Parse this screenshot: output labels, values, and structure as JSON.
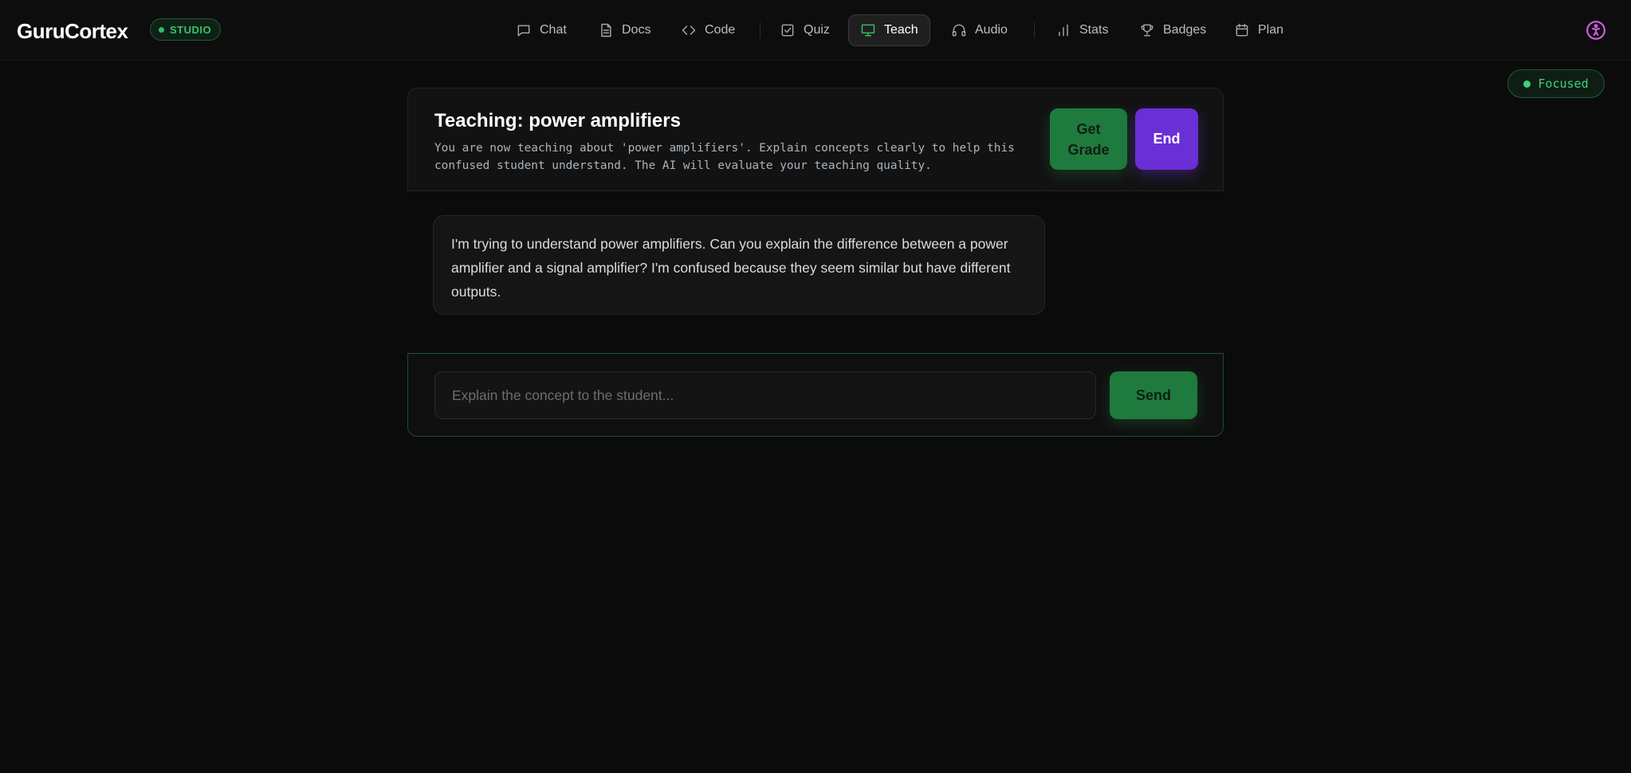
{
  "app": {
    "logo": "GuruCortex",
    "badge": "STUDIO"
  },
  "nav": {
    "items": [
      {
        "label": "Chat",
        "icon": "chat-icon"
      },
      {
        "label": "Docs",
        "icon": "document-icon"
      },
      {
        "label": "Code",
        "icon": "code-icon"
      },
      {
        "label": "Quiz",
        "icon": "checkbox-icon"
      },
      {
        "label": "Teach",
        "icon": "presentation-icon",
        "active": true
      },
      {
        "label": "Audio",
        "icon": "headphones-icon"
      },
      {
        "label": "Stats",
        "icon": "bar-chart-icon"
      },
      {
        "label": "Badges",
        "icon": "trophy-icon"
      },
      {
        "label": "Plan",
        "icon": "calendar-icon"
      }
    ],
    "accessibility_icon": "accessibility-icon"
  },
  "status": {
    "focused_label": "Focused",
    "color": "#3bd27a"
  },
  "teach": {
    "title": "Teaching: power amplifiers",
    "description": "You are now teaching about 'power amplifiers'. Explain concepts clearly to help this confused student understand. The AI will evaluate your teaching quality.",
    "grade_button": "Get Grade",
    "end_button": "End",
    "student_message": "I'm trying to understand power amplifiers. Can you explain the difference between a power amplifier and a signal amplifier? I'm confused because they seem similar but have different outputs.",
    "input_placeholder": "Explain the concept to the student...",
    "input_value": "",
    "send_button": "Send"
  },
  "colors": {
    "accent_green": "#1f7a3e",
    "accent_purple": "#6a2fd6",
    "background": "#0b0b0b"
  }
}
